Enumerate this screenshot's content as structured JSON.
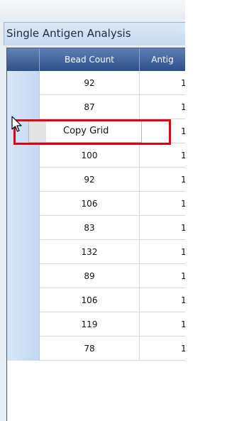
{
  "panel": {
    "title": "Single Antigen Analysis"
  },
  "grid": {
    "columns": [
      "Bead Count",
      "Antig"
    ],
    "rows": [
      {
        "bead_count": "92",
        "antigen": "1"
      },
      {
        "bead_count": "87",
        "antigen": "1"
      },
      {
        "bead_count": "",
        "antigen": "1"
      },
      {
        "bead_count": "100",
        "antigen": "1"
      },
      {
        "bead_count": "92",
        "antigen": "1"
      },
      {
        "bead_count": "106",
        "antigen": "1"
      },
      {
        "bead_count": "83",
        "antigen": "1"
      },
      {
        "bead_count": "132",
        "antigen": "1"
      },
      {
        "bead_count": "89",
        "antigen": "1"
      },
      {
        "bead_count": "106",
        "antigen": "1"
      },
      {
        "bead_count": "119",
        "antigen": "1"
      },
      {
        "bead_count": "78",
        "antigen": "1"
      }
    ]
  },
  "context_menu": {
    "items": [
      {
        "label": "Copy Grid"
      }
    ]
  },
  "colors": {
    "header_bg": "#3a5c96",
    "highlight_border": "#e00016",
    "row_selector": "#c9dcf3"
  },
  "icons": {
    "cursor": "arrow-pointer-icon"
  }
}
